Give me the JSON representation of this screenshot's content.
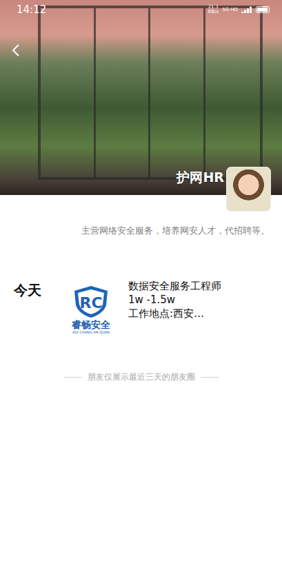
{
  "status_bar": {
    "time": "14:12",
    "speed": "21.1",
    "speed_unit": "KB/s",
    "network": "5G HD",
    "battery_level": 0.95
  },
  "profile": {
    "name": "护网HR",
    "signature": "主营网络安全服务，培养网安人才，代招聘等。"
  },
  "posts": [
    {
      "day": "今天",
      "logo": {
        "letters": "RC",
        "title": "睿畅安全",
        "subtitle": "RUI CHANG AN QUAN"
      },
      "lines": [
        "数据安全服务工程师",
        "1w -1.5w",
        "工作地点:西安…"
      ]
    }
  ],
  "footer": {
    "text": "朋友仅展示最近三天的朋友圈"
  }
}
